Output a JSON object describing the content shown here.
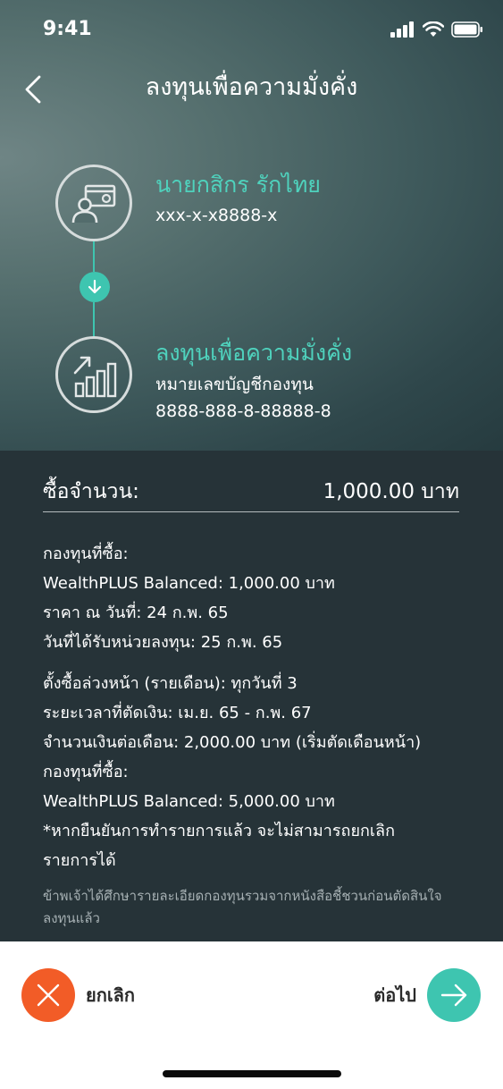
{
  "status_bar": {
    "time": "9:41"
  },
  "header": {
    "title": "ลงทุนเพื่อความมั่งคั่ง"
  },
  "source": {
    "name": "นายกสิกร รักไทย",
    "account": "xxx-x-x8888-x",
    "icon": "person-card-icon"
  },
  "destination": {
    "name": "ลงทุนเพื่อความมั่งคั่ง",
    "account_label": "หมายเลขบัญชีกองทุน",
    "account_number": "8888-888-8-88888-8",
    "icon": "growth-chart-icon"
  },
  "purchase": {
    "label": "ซื้อจำนวน:",
    "amount": "1,000.00 บาท"
  },
  "details": {
    "fund_label": "กองทุนที่ซื้อ:",
    "fund_line": "WealthPLUS Balanced: 1,000.00 บาท",
    "price_date": "ราคา ณ วันที่: 24 ก.พ. 65",
    "units_date": "วันที่ได้รับหน่วยลงทุน: 25 ก.พ. 65",
    "schedule": "ตั้งซื้อล่วงหน้า (รายเดือน): ทุกวันที่ 3",
    "period": "ระยะเวลาที่ตัดเงิน: เม.ย. 65 - ก.พ. 67",
    "monthly": "จำนวนเงินต่อเดือน: 2,000.00 บาท (เริ่มตัดเดือนหน้า)",
    "fund_label_2": "กองทุนที่ซื้อ:",
    "fund_line_2": "WealthPLUS Balanced: 5,000.00 บาท",
    "warning_1": "*หากยืนยันการทำรายการแล้ว จะไม่สามารถยกเลิก",
    "warning_2": "รายการได้"
  },
  "disclaimer": "ข้าพเจ้าได้ศึกษารายละเอียดกองทุนรวมจากหนังสือชี้ชวนก่อนตัดสินใจลงทุนแล้ว",
  "footer": {
    "cancel_label": "ยกเลิก",
    "next_label": "ต่อไป"
  },
  "colors": {
    "accent": "#3ec5b0",
    "accent_text": "#4fd2bd",
    "cancel": "#f25c27",
    "panel": "#263338"
  }
}
